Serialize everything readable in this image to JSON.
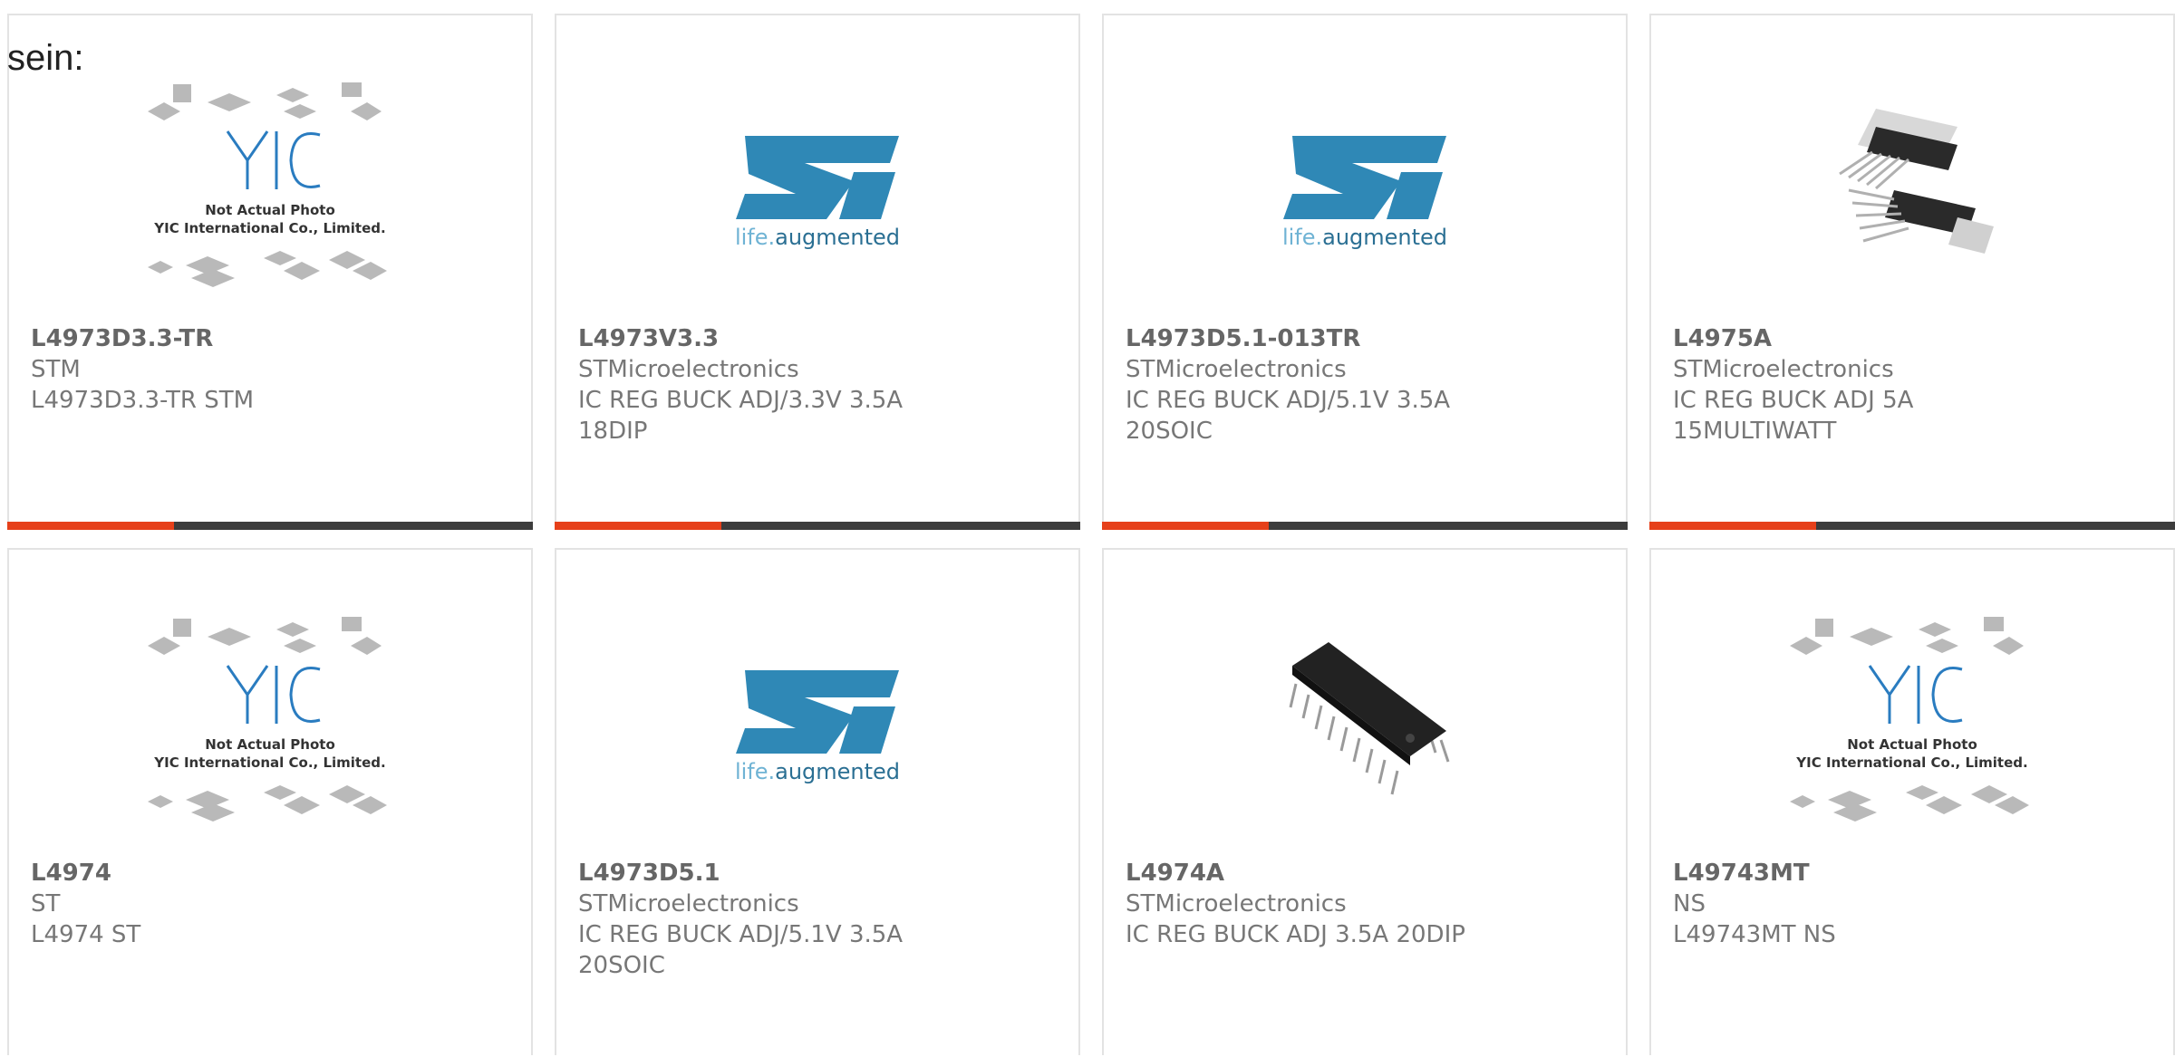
{
  "intro_text": "sein:",
  "colors": {
    "accent": "#e6401a",
    "bar_dark": "#3c3c3c",
    "st_logo_blue": "#2f88b6",
    "st_tagline": "#6fb3d4"
  },
  "placeholder": {
    "line1": "Not Actual Photo",
    "line2": "YIC International Co., Limited."
  },
  "st_logo": {
    "tagline_prefix": "life.",
    "tagline_suffix": "augmented"
  },
  "products": [
    {
      "part": "L4973D3.3-TR",
      "mfr": "STM",
      "desc": "L4973D3.3-TR STM",
      "image": "placeholder-image"
    },
    {
      "part": "L4973V3.3",
      "mfr": "STMicroelectronics",
      "desc": "IC REG BUCK ADJ/3.3V 3.5A\n18DIP",
      "image": "st-logo"
    },
    {
      "part": "L4973D5.1-013TR",
      "mfr": "STMicroelectronics",
      "desc": "IC REG BUCK ADJ/5.1V 3.5A\n20SOIC",
      "image": "st-logo"
    },
    {
      "part": "L4975A",
      "mfr": "STMicroelectronics",
      "desc": "IC REG BUCK ADJ 5A\n15MULTIWATT",
      "image": "multiwatt-package-photo"
    },
    {
      "part": "L4974",
      "mfr": "ST",
      "desc": "L4974 ST",
      "image": "placeholder-image"
    },
    {
      "part": "L4973D5.1",
      "mfr": "STMicroelectronics",
      "desc": "IC REG BUCK ADJ/5.1V 3.5A\n20SOIC",
      "image": "st-logo"
    },
    {
      "part": "L4974A",
      "mfr": "STMicroelectronics",
      "desc": "IC REG BUCK ADJ 3.5A 20DIP",
      "image": "dip-package-photo"
    },
    {
      "part": "L49743MT",
      "mfr": "NS",
      "desc": "L49743MT NS",
      "image": "placeholder-image"
    }
  ]
}
